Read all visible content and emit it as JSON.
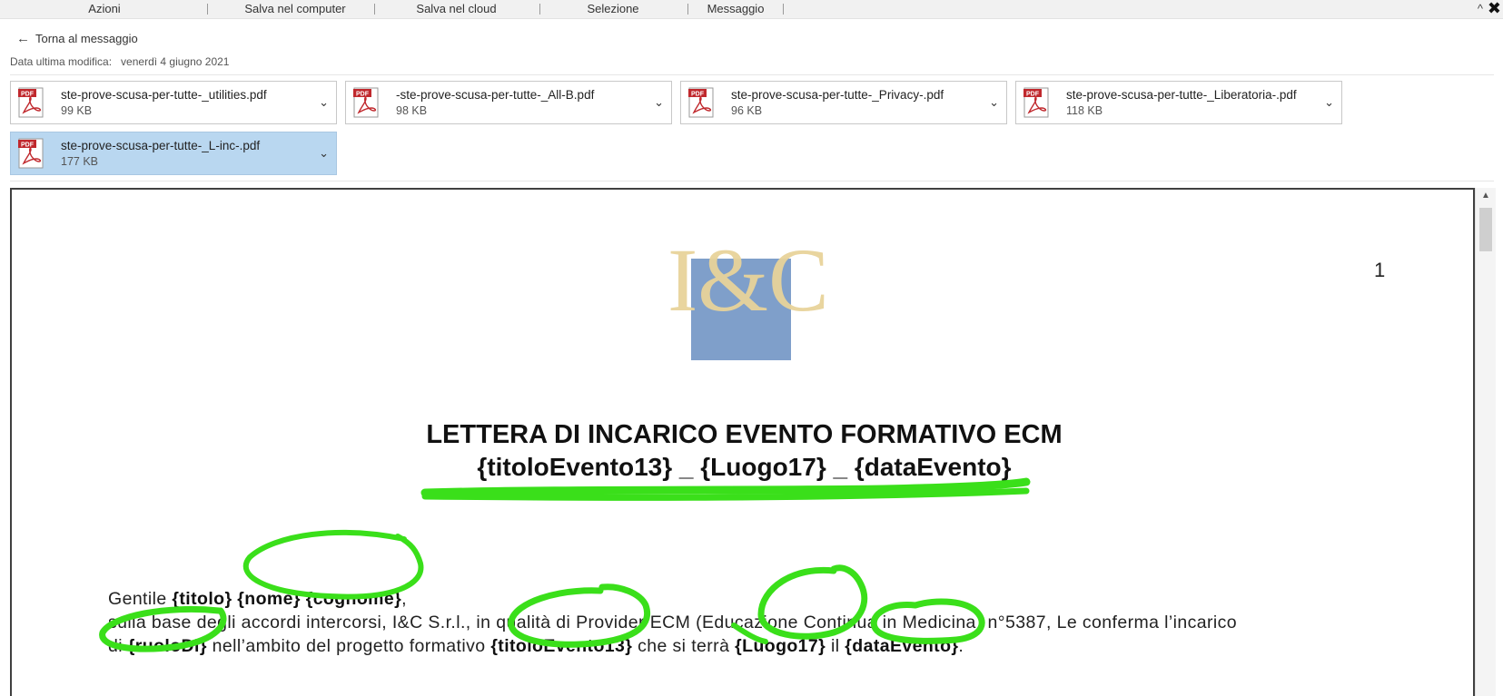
{
  "toolbar": {
    "actions": "Azioni",
    "save_computer": "Salva nel computer",
    "save_cloud": "Salva nel cloud",
    "selection": "Selezione",
    "message": "Messaggio",
    "caret": "^",
    "close": "✖"
  },
  "back": {
    "label": "Torna al messaggio",
    "arrow": "←"
  },
  "meta": {
    "label": "Data ultima modifica:",
    "value": "venerdì 4 giugno 2021"
  },
  "attachments": [
    {
      "name": "ste-prove-scusa-per-tutte-_utilities.pdf",
      "size": "99 KB"
    },
    {
      "name": "-ste-prove-scusa-per-tutte-_All-B.pdf",
      "size": "98 KB"
    },
    {
      "name": "ste-prove-scusa-per-tutte-_Privacy-.pdf",
      "size": "96 KB"
    },
    {
      "name": "ste-prove-scusa-per-tutte-_Liberatoria-.pdf",
      "size": "118 KB"
    },
    {
      "name": "ste-prove-scusa-per-tutte-_L-inc-.pdf",
      "size": "177 KB",
      "selected": true
    }
  ],
  "pdf_badge": "PDF",
  "document": {
    "logo": "I&C",
    "page_number": "1",
    "title_line1": "LETTERA DI INCARICO EVENTO FORMATIVO ECM",
    "title_line2": "{titoloEvento13} _ {Luogo17} _ {dataEvento}",
    "greeting": "Gentile",
    "field_titolo": "{titolo}",
    "field_nome": "{nome}",
    "field_cognome": "{cognome}",
    "comma": ",",
    "line2": "sulla base degli accordi intercorsi, I&C S.r.l., in qualità di Provider ECM (Educazione Continua in Medicina) n°5387, Le conferma l’incarico",
    "line3_a": "di ",
    "field_ruolo": "{ruoloDi}",
    "line3_b": " nell’ambito del progetto formativo ",
    "field_titolo_evento": "{titoloEvento13}",
    "line3_c": " che si terrà ",
    "field_luogo": "{Luogo17}",
    "line3_d": " il ",
    "field_data": "{dataEvento}",
    "line3_e": "."
  },
  "colors": {
    "highlight": "#3adf1a",
    "selected_attachment": "#b9d7f0",
    "pdf_red": "#c0282d"
  }
}
